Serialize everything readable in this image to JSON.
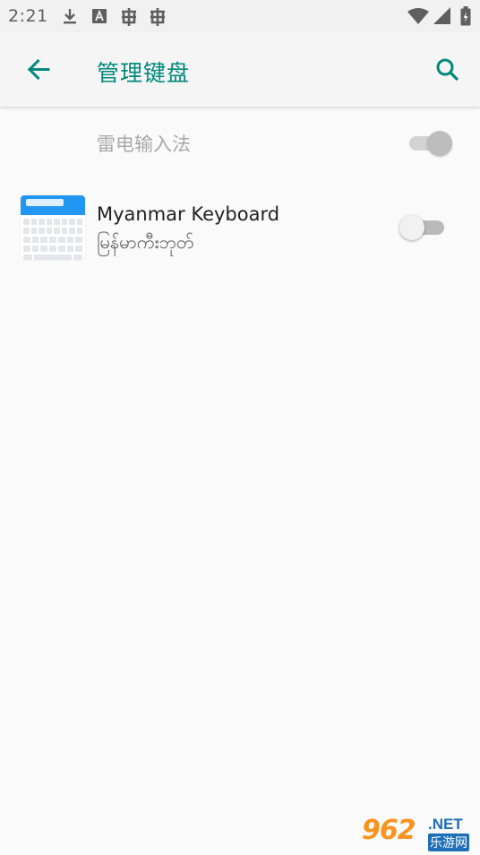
{
  "status_bar": {
    "time": "2:21",
    "icons": [
      "download-icon",
      "app-a-icon",
      "bug-icon",
      "bug-icon",
      "wifi-icon",
      "signal-icon",
      "battery-icon"
    ]
  },
  "app_bar": {
    "title": "管理键盘",
    "back_icon": "arrow-back-icon",
    "search_icon": "search-icon",
    "accent_color": "#00897b"
  },
  "keyboards": [
    {
      "label": "雷电输入法",
      "enabled": true,
      "toggle_disabled": true
    },
    {
      "title": "Myanmar Keyboard",
      "subtitle": "မြန်မာကီးဘုတ်",
      "icon": "myanmar-keyboard-app-icon",
      "enabled": false
    }
  ],
  "watermark": {
    "number": "962",
    "suffix": ".NET",
    "name": "乐游网"
  }
}
